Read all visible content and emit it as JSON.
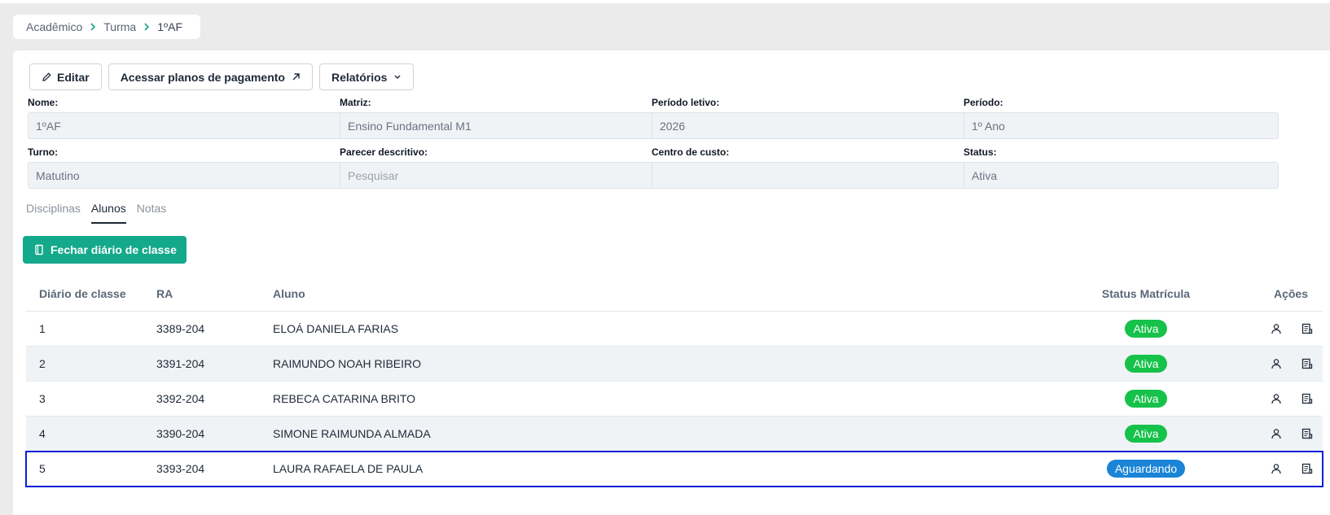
{
  "breadcrumb": {
    "items": [
      "Acadêmico",
      "Turma",
      "1ºAF"
    ]
  },
  "toolbar": {
    "edit_label": "Editar",
    "payment_label": "Acessar planos de pagamento",
    "reports_label": "Relatórios"
  },
  "fields": {
    "nome": {
      "label": "Nome:",
      "value": "1ºAF"
    },
    "matriz": {
      "label": "Matriz:",
      "value": "Ensino Fundamental M1"
    },
    "periodo_letivo": {
      "label": "Período letivo:",
      "value": "2026"
    },
    "periodo": {
      "label": "Período:",
      "value": "1º Ano"
    },
    "turno": {
      "label": "Turno:",
      "value": "Matutino"
    },
    "parecer": {
      "label": "Parecer descritivo:",
      "placeholder": "Pesquisar"
    },
    "centro_custo": {
      "label": "Centro de custo:",
      "value": ""
    },
    "status": {
      "label": "Status:",
      "value": "Ativa"
    }
  },
  "tabs": [
    "Disciplinas",
    "Alunos",
    "Notas"
  ],
  "active_tab": "Alunos",
  "close_diary_label": "Fechar diário de classe",
  "table": {
    "headers": [
      "Diário de classe",
      "RA",
      "Aluno",
      "Status Matrícula",
      "Ações"
    ],
    "rows": [
      {
        "num": "1",
        "ra": "3389-204",
        "name": "ELOÁ DANIELA FARIAS",
        "status": "Ativa"
      },
      {
        "num": "2",
        "ra": "3391-204",
        "name": "RAIMUNDO NOAH RIBEIRO",
        "status": "Ativa"
      },
      {
        "num": "3",
        "ra": "3392-204",
        "name": "REBECA CATARINA BRITO",
        "status": "Ativa"
      },
      {
        "num": "4",
        "ra": "3390-204",
        "name": "SIMONE RAIMUNDA ALMADA",
        "status": "Ativa"
      },
      {
        "num": "5",
        "ra": "3393-204",
        "name": "LAURA RAFAELA DE PAULA",
        "status": "Aguardando"
      }
    ]
  },
  "colors": {
    "accent": "#13a98a",
    "status_ativa": "#16c24a",
    "status_aguardando": "#1a84d6",
    "selection": "#0b1fd6"
  },
  "icons": {
    "edit": "pencil-icon",
    "external": "arrow-up-right-icon",
    "dropdown": "chevron-down-icon",
    "book": "book-icon",
    "user": "user-icon",
    "report": "document-icon"
  }
}
